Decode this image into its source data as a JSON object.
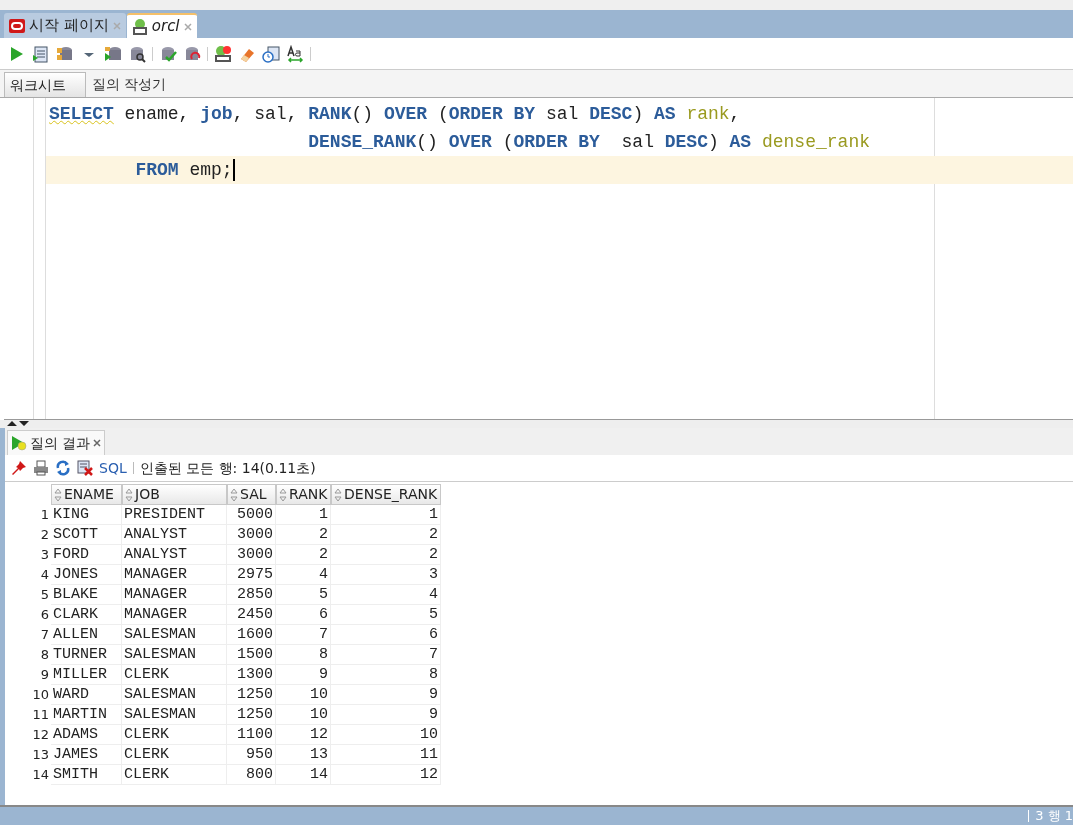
{
  "editor_tabs": [
    {
      "label": "시작 페이지",
      "selected": false,
      "kind": "start"
    },
    {
      "label": "orcl",
      "selected": true,
      "kind": "sql"
    }
  ],
  "worksheet_tabs": [
    {
      "label": "워크시트",
      "selected": true
    },
    {
      "label": "질의 작성기",
      "selected": false
    }
  ],
  "code_lines": [
    {
      "current": false,
      "tokens": [
        {
          "kind": "keyword",
          "text": "SELECT"
        },
        {
          "kind": "plain",
          "text": " ename, "
        },
        {
          "kind": "keyword",
          "text": "job"
        },
        {
          "kind": "plain",
          "text": ", sal, "
        },
        {
          "kind": "keyword",
          "text": "RANK"
        },
        {
          "kind": "plain",
          "text": "() "
        },
        {
          "kind": "keyword",
          "text": "OVER"
        },
        {
          "kind": "plain",
          "text": " ("
        },
        {
          "kind": "keyword",
          "text": "ORDER BY"
        },
        {
          "kind": "plain",
          "text": " sal "
        },
        {
          "kind": "keyword",
          "text": "DESC"
        },
        {
          "kind": "plain",
          "text": ") "
        },
        {
          "kind": "keyword",
          "text": "AS "
        },
        {
          "kind": "alias",
          "text": "rank"
        },
        {
          "kind": "plain",
          "text": ","
        }
      ]
    },
    {
      "current": false,
      "tokens": [
        {
          "kind": "keyword",
          "text": "                        DENSE_RANK"
        },
        {
          "kind": "plain",
          "text": "() "
        },
        {
          "kind": "keyword",
          "text": "OVER"
        },
        {
          "kind": "plain",
          "text": " ("
        },
        {
          "kind": "keyword",
          "text": "ORDER BY"
        },
        {
          "kind": "plain",
          "text": "  sal "
        },
        {
          "kind": "keyword",
          "text": "DESC"
        },
        {
          "kind": "plain",
          "text": ") "
        },
        {
          "kind": "keyword",
          "text": "AS "
        },
        {
          "kind": "alias",
          "text": "dense_rank"
        }
      ]
    },
    {
      "current": true,
      "tokens": [
        {
          "kind": "keyword",
          "text": "        FROM"
        },
        {
          "kind": "plain",
          "text": " emp;"
        }
      ]
    }
  ],
  "results": {
    "tab": {
      "label": "질의 결과",
      "selected": true
    },
    "sql_link": "SQL",
    "status": "인출된 모든 행: 14(0.11초)",
    "columns": [
      {
        "label": "ENAME",
        "kind": "text"
      },
      {
        "label": "JOB",
        "kind": "text"
      },
      {
        "label": "SAL",
        "kind": "number"
      },
      {
        "label": "RANK",
        "kind": "number"
      },
      {
        "label": "DENSE_RANK",
        "kind": "number"
      }
    ],
    "rows": [
      {
        "number": "1",
        "cells": [
          "KING",
          "PRESIDENT",
          "5000",
          "1",
          "1"
        ]
      },
      {
        "number": "2",
        "cells": [
          "SCOTT",
          "ANALYST",
          "3000",
          "2",
          "2"
        ]
      },
      {
        "number": "3",
        "cells": [
          "FORD",
          "ANALYST",
          "3000",
          "2",
          "2"
        ]
      },
      {
        "number": "4",
        "cells": [
          "JONES",
          "MANAGER",
          "2975",
          "4",
          "3"
        ]
      },
      {
        "number": "5",
        "cells": [
          "BLAKE",
          "MANAGER",
          "2850",
          "5",
          "4"
        ]
      },
      {
        "number": "6",
        "cells": [
          "CLARK",
          "MANAGER",
          "2450",
          "6",
          "5"
        ]
      },
      {
        "number": "7",
        "cells": [
          "ALLEN",
          "SALESMAN",
          "1600",
          "7",
          "6"
        ]
      },
      {
        "number": "8",
        "cells": [
          "TURNER",
          "SALESMAN",
          "1500",
          "8",
          "7"
        ]
      },
      {
        "number": "9",
        "cells": [
          "MILLER",
          "CLERK",
          "1300",
          "9",
          "8"
        ]
      },
      {
        "number": "10",
        "cells": [
          "WARD",
          "SALESMAN",
          "1250",
          "10",
          "9"
        ]
      },
      {
        "number": "11",
        "cells": [
          "MARTIN",
          "SALESMAN",
          "1250",
          "10",
          "9"
        ]
      },
      {
        "number": "12",
        "cells": [
          "ADAMS",
          "CLERK",
          "1100",
          "12",
          "10"
        ]
      },
      {
        "number": "13",
        "cells": [
          "JAMES",
          "CLERK",
          "950",
          "13",
          "11"
        ]
      },
      {
        "number": "14",
        "cells": [
          "SMITH",
          "CLERK",
          "800",
          "14",
          "12"
        ]
      }
    ]
  },
  "status_bar": {
    "position": "3 행 1"
  }
}
